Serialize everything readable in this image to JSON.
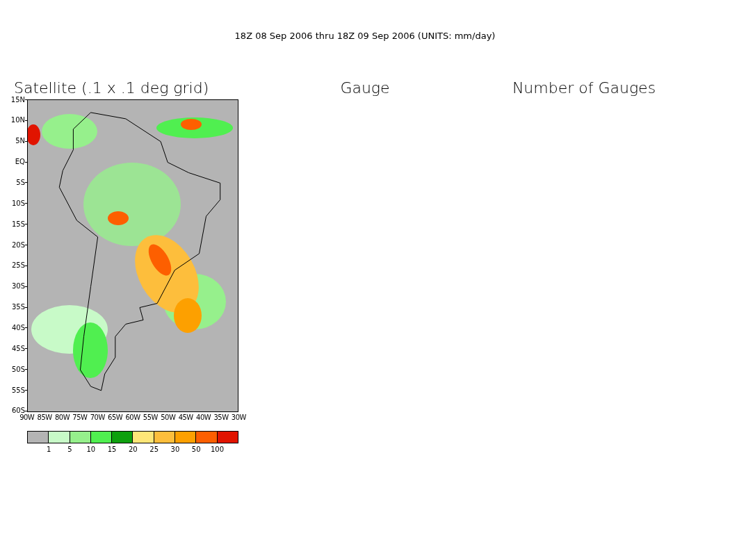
{
  "title": "18Z 08 Sep 2006 thru 18Z 09 Sep 2006 (UNITS: mm/day)",
  "panels": [
    {
      "title": "Satellite (.1 x .1 deg grid)"
    },
    {
      "title": "Gauge"
    },
    {
      "title": "Number of Gauges"
    }
  ],
  "map": {
    "y_ticks": [
      "15N",
      "10N",
      "5N",
      "EQ",
      "5S",
      "10S",
      "15S",
      "20S",
      "25S",
      "30S",
      "35S",
      "40S",
      "45S",
      "50S",
      "55S",
      "60S"
    ],
    "x_ticks": [
      "90W",
      "85W",
      "80W",
      "75W",
      "70W",
      "65W",
      "60W",
      "55W",
      "50W",
      "45W",
      "40W",
      "35W",
      "30W"
    ]
  },
  "legend": {
    "bins": [
      {
        "color": "#b4b4b4"
      },
      {
        "color": "#c8fac8"
      },
      {
        "color": "#96f08c"
      },
      {
        "color": "#50ef50"
      },
      {
        "color": "#0ea00e"
      },
      {
        "color": "#fee678"
      },
      {
        "color": "#fdbe3c"
      },
      {
        "color": "#fda000"
      },
      {
        "color": "#fd5f00"
      },
      {
        "color": "#e11400"
      }
    ],
    "labels": [
      "1",
      "5",
      "10",
      "15",
      "20",
      "25",
      "30",
      "50",
      "100"
    ]
  }
}
